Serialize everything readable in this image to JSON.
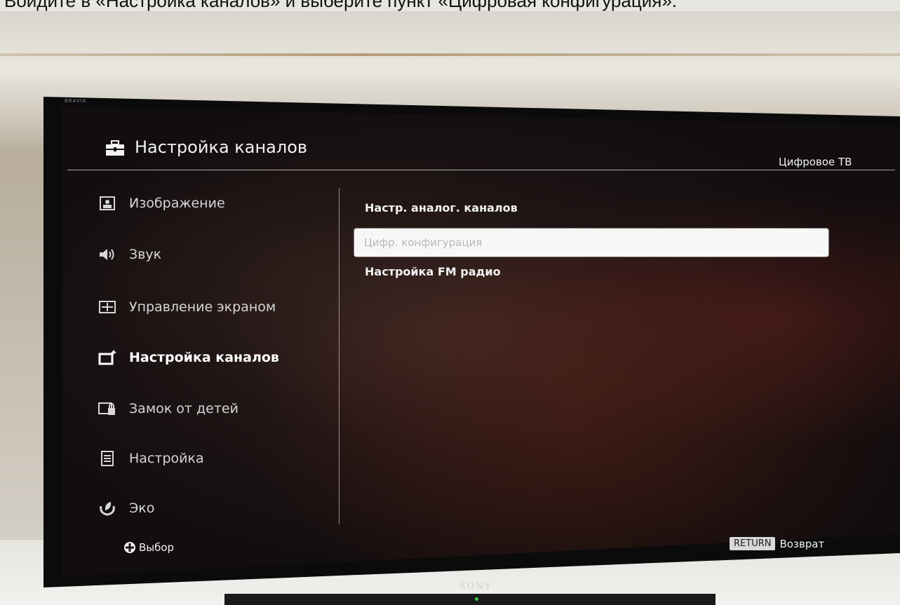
{
  "caption": "Войдите в «Настройка каналов» и выберите пункт «Цифровая конфигурация».",
  "tv": {
    "brand": "SONY",
    "model_label": "BRAVIA"
  },
  "header": {
    "title": "Настройка каналов",
    "icon": "toolbox-icon",
    "right_label": "Цифровое ТВ"
  },
  "sidebar": {
    "items": [
      {
        "label": "Изображение",
        "icon": "picture-icon",
        "active": false
      },
      {
        "label": "Звук",
        "icon": "speaker-icon",
        "active": false
      },
      {
        "label": "Управление экраном",
        "icon": "screen-control-icon",
        "active": false
      },
      {
        "label": "Настройка каналов",
        "icon": "channel-setup-icon",
        "active": true
      },
      {
        "label": "Замок от детей",
        "icon": "parental-lock-icon",
        "active": false
      },
      {
        "label": "Настройка",
        "icon": "settings-list-icon",
        "active": false
      },
      {
        "label": "Эко",
        "icon": "eco-leaf-icon",
        "active": false
      }
    ]
  },
  "menu": {
    "items": [
      {
        "label": "Настр. аналог. каналов",
        "selected": false
      },
      {
        "label": "Цифр. конфигурация",
        "selected": true
      },
      {
        "label": "Настройка FM радио",
        "selected": false
      }
    ]
  },
  "footer": {
    "select_label": "Выбор",
    "return_key": "RETURN",
    "return_label": "Возврат"
  },
  "colors": {
    "text": "#f2f2f2",
    "selection_bg": "#f7f7f7",
    "selection_text": "#b8b8b8"
  }
}
